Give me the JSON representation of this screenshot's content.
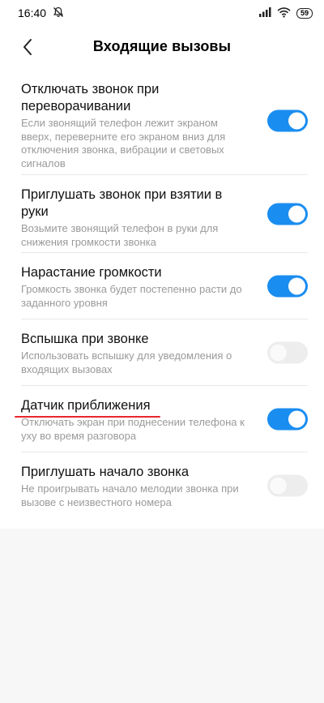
{
  "status_bar": {
    "time": "16:40",
    "battery": "59",
    "icons": [
      "bell-off-icon",
      "signal-icon",
      "wifi-icon",
      "battery-icon"
    ]
  },
  "header": {
    "title": "Входящие вызовы",
    "back_icon": "chevron-left-icon"
  },
  "colors": {
    "accent": "#1a8df0",
    "highlight_underline": "#e8262c",
    "secondary_text": "#9a9a9a"
  },
  "settings": [
    {
      "title": "Отключать звонок при переворачивании",
      "description": "Если звонящий телефон лежит экраном вверх, переверните его экраном вниз для отключения звонка, вибрации и световых сигналов",
      "enabled": true
    },
    {
      "title": "Приглушать звонок при взятии в руки",
      "description": "Возьмите звонящий телефон в руки для снижения громкости звонка",
      "enabled": true
    },
    {
      "title": "Нарастание громкости",
      "description": "Громкость звонка будет постепенно расти до заданного уровня",
      "enabled": true
    },
    {
      "title": "Вспышка при звонке",
      "description": "Использовать вспышку для уведомления о входящих вызовах",
      "enabled": false
    },
    {
      "title": "Датчик приближения",
      "description": "Отключать экран при поднесении телефона к уху во время разговора",
      "enabled": true
    },
    {
      "title": "Приглушать начало звонка",
      "description": "Не проигрывать начало мелодии звонка при вызове с неизвестного номера",
      "enabled": false
    }
  ]
}
